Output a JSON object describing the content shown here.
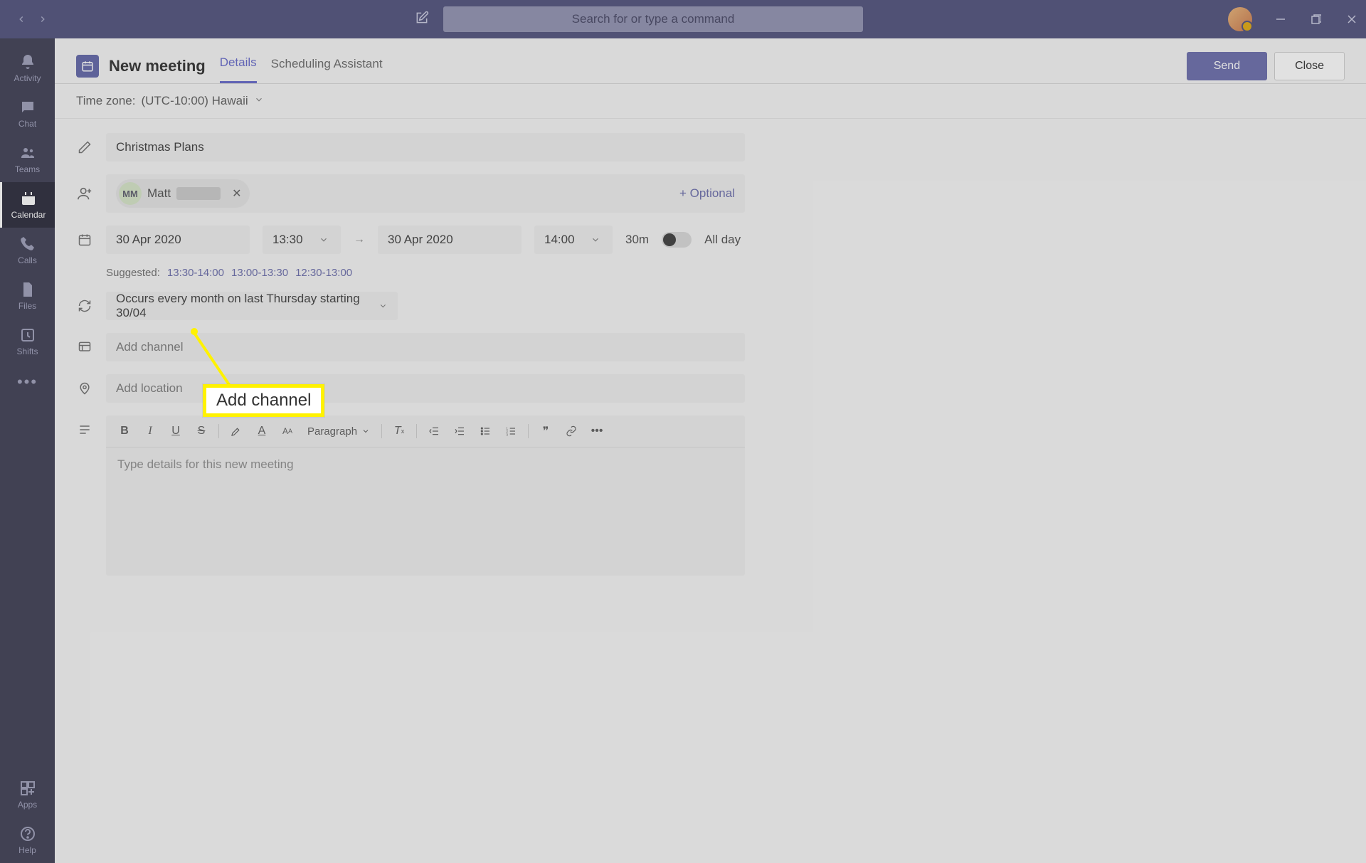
{
  "search": {
    "placeholder": "Search for or type a command"
  },
  "sidebar": {
    "items": [
      {
        "label": "Activity"
      },
      {
        "label": "Chat"
      },
      {
        "label": "Teams"
      },
      {
        "label": "Calendar"
      },
      {
        "label": "Calls"
      },
      {
        "label": "Files"
      },
      {
        "label": "Shifts"
      }
    ],
    "apps_label": "Apps",
    "help_label": "Help"
  },
  "header": {
    "title": "New meeting",
    "tabs": [
      {
        "label": "Details",
        "active": true
      },
      {
        "label": "Scheduling Assistant",
        "active": false
      }
    ],
    "send_label": "Send",
    "close_label": "Close"
  },
  "timezone": {
    "label": "Time zone:",
    "value": "(UTC-10:00) Hawaii"
  },
  "form": {
    "title_value": "Christmas Plans",
    "attendee": {
      "initials": "MM",
      "name": "Matt"
    },
    "optional_label": "+ Optional",
    "start_date": "30 Apr 2020",
    "start_time": "13:30",
    "end_date": "30 Apr 2020",
    "end_time": "14:00",
    "duration": "30m",
    "all_day_label": "All day",
    "suggested_label": "Suggested:",
    "suggested": [
      "13:30-14:00",
      "13:00-13:30",
      "12:30-13:00"
    ],
    "recurrence": "Occurs every month on last Thursday starting 30/04",
    "channel_placeholder": "Add channel",
    "location_placeholder": "Add location",
    "paragraph_label": "Paragraph",
    "body_placeholder": "Type details for this new meeting"
  },
  "annotation": {
    "callout_text": "Add channel"
  }
}
